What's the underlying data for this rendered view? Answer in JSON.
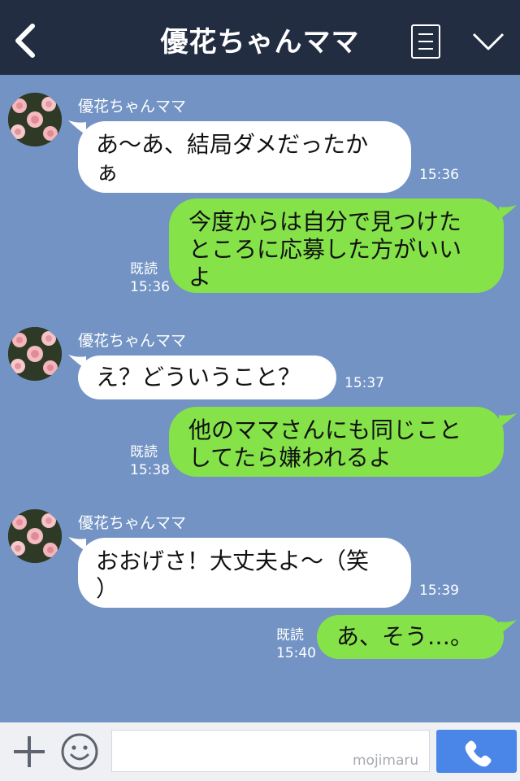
{
  "header": {
    "title": "優花ちゃんママ"
  },
  "messages": [
    {
      "sender": "優花ちゃんママ",
      "line1": "あ〜あ、結局ダメだったか",
      "line2": "ぁ",
      "time": "15:36"
    },
    {
      "line1": "今度からは自分で見つけた",
      "line2": "ところに応募した方がいい",
      "line3": "よ",
      "read": "既読",
      "time": "15:36"
    },
    {
      "sender": "優花ちゃんママ",
      "text": "え？どういうこと？",
      "time": "15:37"
    },
    {
      "line1": "他のママさんにも同じこと",
      "line2": "してたら嫌われるよ",
      "read": "既読",
      "time": "15:38"
    },
    {
      "sender": "優花ちゃんママ",
      "line1": "おおげさ！大丈夫よ〜（笑",
      "line2": "）",
      "time": "15:39"
    },
    {
      "text": "あ、そう…。",
      "read": "既読",
      "time": "15:40"
    }
  ],
  "footer": {
    "watermark": "mojimaru"
  },
  "colors": {
    "header_bg": "#232d42",
    "chat_bg": "#7293c4",
    "bubble_out": "#85e249",
    "bubble_in": "#ffffff",
    "call_button": "#4a86e8"
  },
  "icons": [
    "back-arrow-icon",
    "menu-icon",
    "chevron-down-icon",
    "avatar-roses",
    "plus-icon",
    "smiley-icon",
    "phone-icon"
  ]
}
